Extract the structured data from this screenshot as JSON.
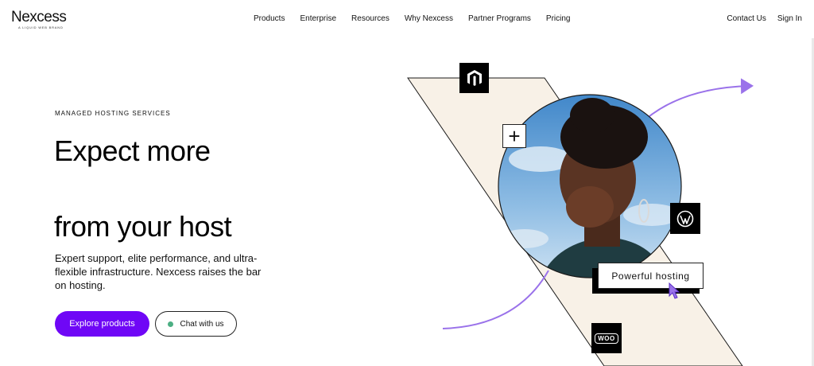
{
  "brand": {
    "name": "Nexcess",
    "tagline": "A LIQUID WEB BRAND"
  },
  "nav": {
    "links": [
      "Products",
      "Enterprise",
      "Resources",
      "Why Nexcess",
      "Partner Programs",
      "Pricing"
    ],
    "contact": "Contact Us",
    "signin": "Sign In"
  },
  "hero": {
    "eyebrow": "MANAGED HOSTING SERVICES",
    "headline_line1": "Expect more",
    "headline_line2": "from your host",
    "description": "Expert support, elite performance, and ultra-flexible infrastructure. Nexcess raises the bar on hosting.",
    "primary_button": "Explore products",
    "secondary_button": "Chat with us",
    "chip_label": "Powerful hosting",
    "plus_symbol": "+",
    "woo_label": "WOO"
  },
  "colors": {
    "accent": "#6f07f6",
    "chat_dot": "#4caf83",
    "diagonal_band": "#f8f1e7",
    "arrow_purple": "#9a72ea"
  },
  "icons": [
    "magento-icon",
    "wordpress-icon",
    "woocommerce-icon",
    "plus-icon",
    "cursor-icon",
    "arrow-icon"
  ]
}
